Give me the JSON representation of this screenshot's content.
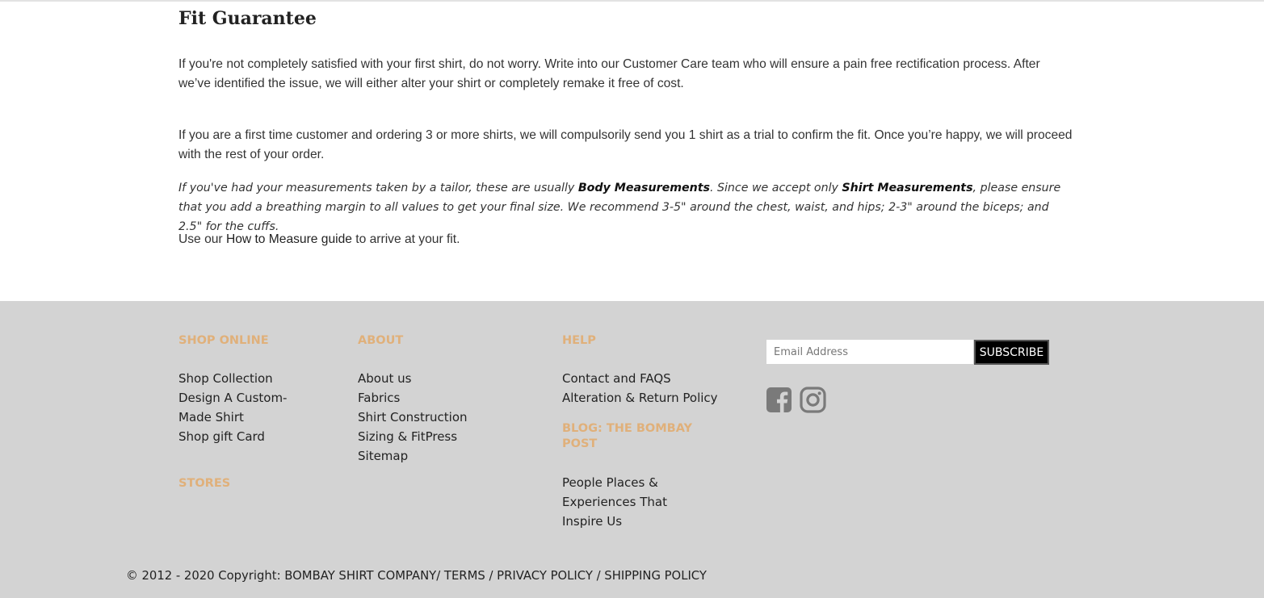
{
  "fit": {
    "title": "Fit Guarantee",
    "para1": "If you're not completely satisfied with your first shirt, do not worry. Write into our Customer Care team who will ensure a pain free rectification process. After we’ve identified the issue, we will either alter your shirt or completely remake it free of cost.",
    "para2": "If you are a first time customer and ordering 3 or more shirts, we will compulsorily send you 1 shirt as a trial to confirm the fit. Once you’re happy, we will proceed with the rest of your order.",
    "para3": {
      "part1": "If you've had your measurements taken by a tailor, these are usually ",
      "bold1": "Body Measurements",
      "part2": ". Since we accept only ",
      "bold2": "Shirt Measurements",
      "part3": ", please ensure that you add a breathing margin to all values to get your final size. We recommend 3-5\" around the chest, waist, and hips; 2-3\" around the biceps; and 2.5\" for the cuffs."
    },
    "para4": {
      "prefix": "Use our ",
      "link": "How to Measure guide",
      "suffix": " to arrive at your fit."
    }
  },
  "footer": {
    "shop": {
      "heading": "SHOP ONLINE",
      "links": [
        "Shop Collection",
        "Design A Custom-Made Shirt",
        "Shop gift Card"
      ]
    },
    "stores": {
      "heading": "STORES"
    },
    "about": {
      "heading": "ABOUT",
      "links": [
        "About us",
        "Fabrics",
        "Shirt Construction",
        "Sizing & FitPress",
        "Sitemap"
      ]
    },
    "help": {
      "heading": "HELP",
      "links": [
        "Contact and FAQS",
        "Alteration & Return Policy"
      ]
    },
    "blog": {
      "heading": "BLOG: THE BOMBAY POST",
      "links": [
        "People Places & Experiences That Inspire Us"
      ]
    },
    "newsletter": {
      "placeholder": "Email Address",
      "button": "SUBSCRIBE"
    },
    "social": {
      "icons": [
        "facebook-icon",
        "instagram-icon"
      ],
      "icon_color": "#7a7a7a"
    },
    "copyright": {
      "text": "© 2012 - 2020 Copyright: ",
      "company": "BOMBAY SHIRT COMPANY",
      "sep1": "/ ",
      "terms": "TERMS",
      "sep2": " / ",
      "privacy": "PRIVACY POLICY",
      "sep3": " / ",
      "shipping": "SHIPPING POLICY"
    },
    "colors": {
      "background": "#d3d3d3",
      "heading": "#e0b07a"
    }
  }
}
